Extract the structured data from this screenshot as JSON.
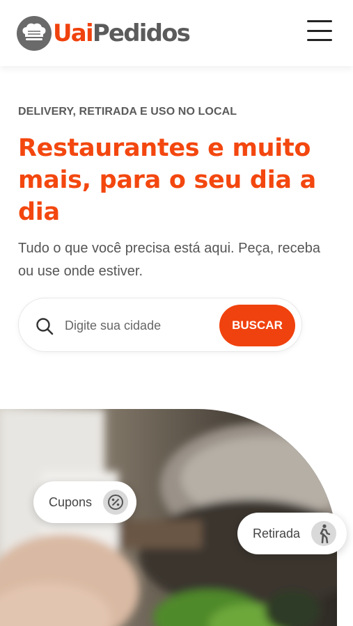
{
  "header": {
    "logo_text_accent": "Uai",
    "logo_text_main": "Pedidos",
    "menu_icon": "hamburger-menu-icon"
  },
  "hero": {
    "eyebrow": "DELIVERY, RETIRADA E USO NO LOCAL",
    "headline": "Restaurantes e muito mais, para o seu dia a dia",
    "subtitle": "Tudo o que você precisa está aqui. Peça, receba ou use onde estiver."
  },
  "search": {
    "placeholder": "Digite sua cidade",
    "value": "",
    "button_label": "BUSCAR",
    "icon": "search-icon"
  },
  "features": [
    {
      "label": "Cupons",
      "icon": "percent-badge-icon"
    },
    {
      "label": "Retirada",
      "icon": "walking-person-icon"
    }
  ],
  "colors": {
    "brand_orange": "#f0420e",
    "logo_gray": "#5b5b5b"
  }
}
